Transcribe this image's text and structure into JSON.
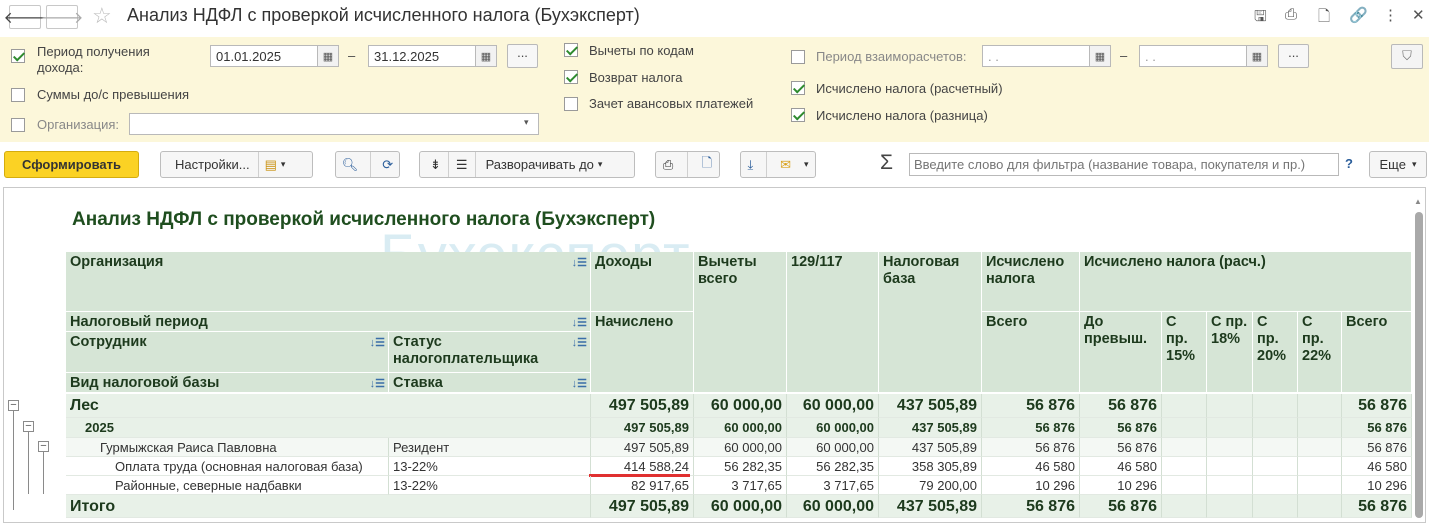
{
  "window": {
    "title": "Анализ НДФЛ с проверкой исчисленного налога (Бухэксперт)",
    "back_icon": "arrow-left-icon",
    "forward_icon": "arrow-right-icon",
    "favorite_icon": "star-icon"
  },
  "params": {
    "period_label": "Период получения дохода:",
    "date_from": "01.01.2025",
    "date_to": "31.12.2025",
    "dash": "–",
    "dots": "...",
    "sums_label": "Суммы до/с превышения",
    "org_label": "Организация:",
    "org_value": "",
    "deductions_label": "Вычеты по кодам",
    "refund_label": "Возврат налога",
    "advance_label": "Зачет авансовых платежей",
    "settle_label": "Период взаиморасчетов:",
    "settle_from": ". .",
    "settle_to": ". .",
    "calc_label": "Исчислено налога (расчетный)",
    "diff_label": "Исчислено налога (разница)"
  },
  "toolbar": {
    "generate": "Сформировать",
    "settings": "Настройки...",
    "expand": "Разворачивать до",
    "sigma": "Σ",
    "filter_placeholder": "Введите слово для фильтра (название товара, покупателя и пр.)",
    "help": "?",
    "more": "Еще"
  },
  "report": {
    "title": "Анализ НДФЛ с проверкой исчисленного налога (Бухэксперт)",
    "watermark": "Бухэксперт",
    "headers": {
      "org": "Организация",
      "income": "Доходы",
      "deductions": "Вычеты всего",
      "c129": "129/117",
      "base": "Налоговая база",
      "calc": "Исчислено налога",
      "calc_r": "Исчислено налога (расч.)",
      "period": "Налоговый период",
      "accrued": "Начислено",
      "total": "Всего",
      "before": "До превыш.",
      "p15": "С пр. 15%",
      "p18": "С пр. 18%",
      "p20": "С пр. 20%",
      "p22": "С пр. 22%",
      "total2": "Всего",
      "employee": "Сотрудник",
      "status": "Статус налогоплательщика",
      "base_type": "Вид налоговой базы",
      "rate": "Ставка"
    },
    "rows": [
      {
        "name": "Лес",
        "status": "",
        "income": "497 505,89",
        "ded": "60 000,00",
        "c129": "60 000,00",
        "base": "437 505,89",
        "calc": "56 876",
        "before": "56 876",
        "p15": "",
        "p18": "",
        "p20": "",
        "p22": "",
        "total": "56 876"
      },
      {
        "name": "2025",
        "status": "",
        "income": "497 505,89",
        "ded": "60 000,00",
        "c129": "60 000,00",
        "base": "437 505,89",
        "calc": "56 876",
        "before": "56 876",
        "p15": "",
        "p18": "",
        "p20": "",
        "p22": "",
        "total": "56 876"
      },
      {
        "name": "Гурмыжская Раиса Павловна",
        "status": "Резидент",
        "income": "497 505,89",
        "ded": "60 000,00",
        "c129": "60 000,00",
        "base": "437 505,89",
        "calc": "56 876",
        "before": "56 876",
        "p15": "",
        "p18": "",
        "p20": "",
        "p22": "",
        "total": "56 876"
      },
      {
        "name": "Оплата труда (основная налоговая база)",
        "status": "13-22%",
        "income": "414 588,24",
        "ded": "56 282,35",
        "c129": "56 282,35",
        "base": "358 305,89",
        "calc": "46 580",
        "before": "46 580",
        "p15": "",
        "p18": "",
        "p20": "",
        "p22": "",
        "total": "46 580"
      },
      {
        "name": "Районные, северные надбавки",
        "status": "13-22%",
        "income": "82 917,65",
        "ded": "3 717,65",
        "c129": "3 717,65",
        "base": "79 200,00",
        "calc": "10 296",
        "before": "10 296",
        "p15": "",
        "p18": "",
        "p20": "",
        "p22": "",
        "total": "10 296"
      },
      {
        "name": "Итого",
        "status": "",
        "income": "497 505,89",
        "ded": "60 000,00",
        "c129": "60 000,00",
        "base": "437 505,89",
        "calc": "56 876",
        "before": "56 876",
        "p15": "",
        "p18": "",
        "p20": "",
        "p22": "",
        "total": "56 876"
      }
    ]
  },
  "colors": {
    "accent": "#fbd224",
    "panel": "#fcf7da",
    "header": "#d6e5d6",
    "highlight": "#e03030"
  }
}
